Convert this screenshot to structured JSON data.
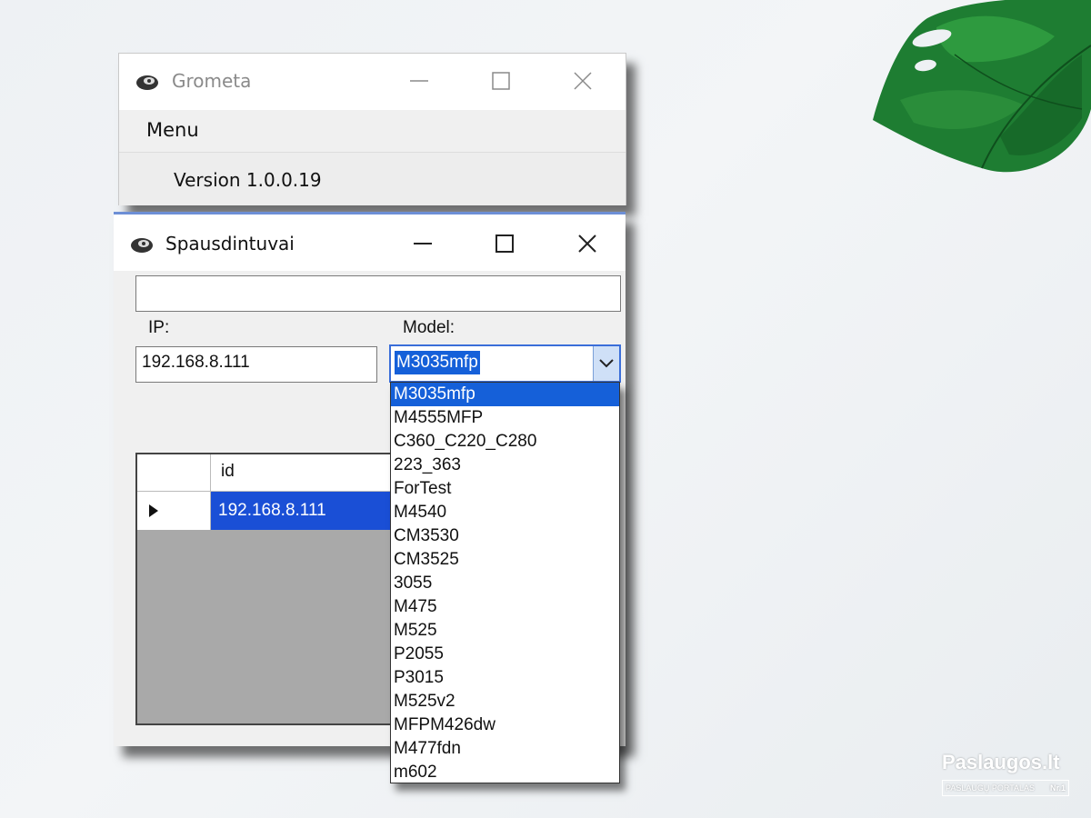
{
  "main_window": {
    "title": "Grometa",
    "menu_label": "Menu",
    "version_label": "Version 1.0.0.19"
  },
  "child_window": {
    "title": "Spausdintuvai",
    "top_input_value": "",
    "ip_label": "IP:",
    "ip_value": "192.168.8.111",
    "model_label": "Model:",
    "model_value": "M3035mfp",
    "grid": {
      "column_header": "id",
      "rows": [
        "192.168.8.111"
      ]
    }
  },
  "model_options": [
    "M3035mfp",
    "M4555MFP",
    "C360_C220_C280",
    "223_363",
    "ForTest",
    "M4540",
    "CM3530",
    "CM3525",
    "3055",
    "M475",
    "M525",
    "P2055",
    "P3015",
    "M525v2",
    "MFPM426dw",
    "M477fdn",
    "m602"
  ],
  "selected_option_index": 0,
  "watermark": {
    "brand": "Paslaugos.lt",
    "tagline": "PASLAUGŲ PORTALAS",
    "rank": "Nr.1"
  },
  "icons": [
    "app-icon",
    "minimize-icon",
    "maximize-icon",
    "close-icon",
    "chevron-down-icon",
    "row-pointer-icon",
    "plant-leaf-icon"
  ]
}
